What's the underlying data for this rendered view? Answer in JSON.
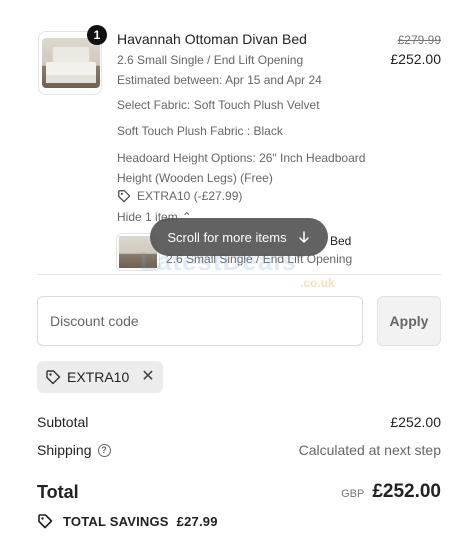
{
  "cart_item": {
    "quantity": "1",
    "title": "Havannah Ottoman Divan Bed",
    "variant": "2.6 Small Single / End Lift Opening",
    "estimate": "Estimated between: Apr 15 and Apr 24",
    "fabric": "Select Fabric: Soft Touch Plush Velvet",
    "fabric_color": "Soft Touch Plush Fabric : Black",
    "headboard_line1": "Headoard Height Options: 26\" Inch Headboard",
    "headboard_line2": "Height (Wooden Legs) (Free)",
    "discount_applied": "EXTRA10 (-£27.99)",
    "original_price": "£279.99",
    "price": "£252.00",
    "hide_items": "Hide 1 item"
  },
  "second_item": {
    "title_fragment": "Bed",
    "variant": "2.6 Small Single / End Lift Opening"
  },
  "scroll_hint": {
    "label": "Scroll for more items",
    "icon": "arrow-down-icon"
  },
  "watermark": {
    "text": "LatestDeals",
    "suffix": ".co.uk"
  },
  "discount": {
    "placeholder": "Discount code",
    "apply_label": "Apply",
    "code_chip": "EXTRA10"
  },
  "summary": {
    "subtotal_label": "Subtotal",
    "subtotal_value": "£252.00",
    "shipping_label": "Shipping",
    "shipping_value": "Calculated at next step",
    "total_label": "Total",
    "currency": "GBP",
    "total_value": "£252.00",
    "savings_label": "TOTAL SAVINGS",
    "savings_value": "£27.99"
  },
  "colors": {
    "badge": "#111111",
    "pill": "#555555",
    "muted": "#666666"
  }
}
